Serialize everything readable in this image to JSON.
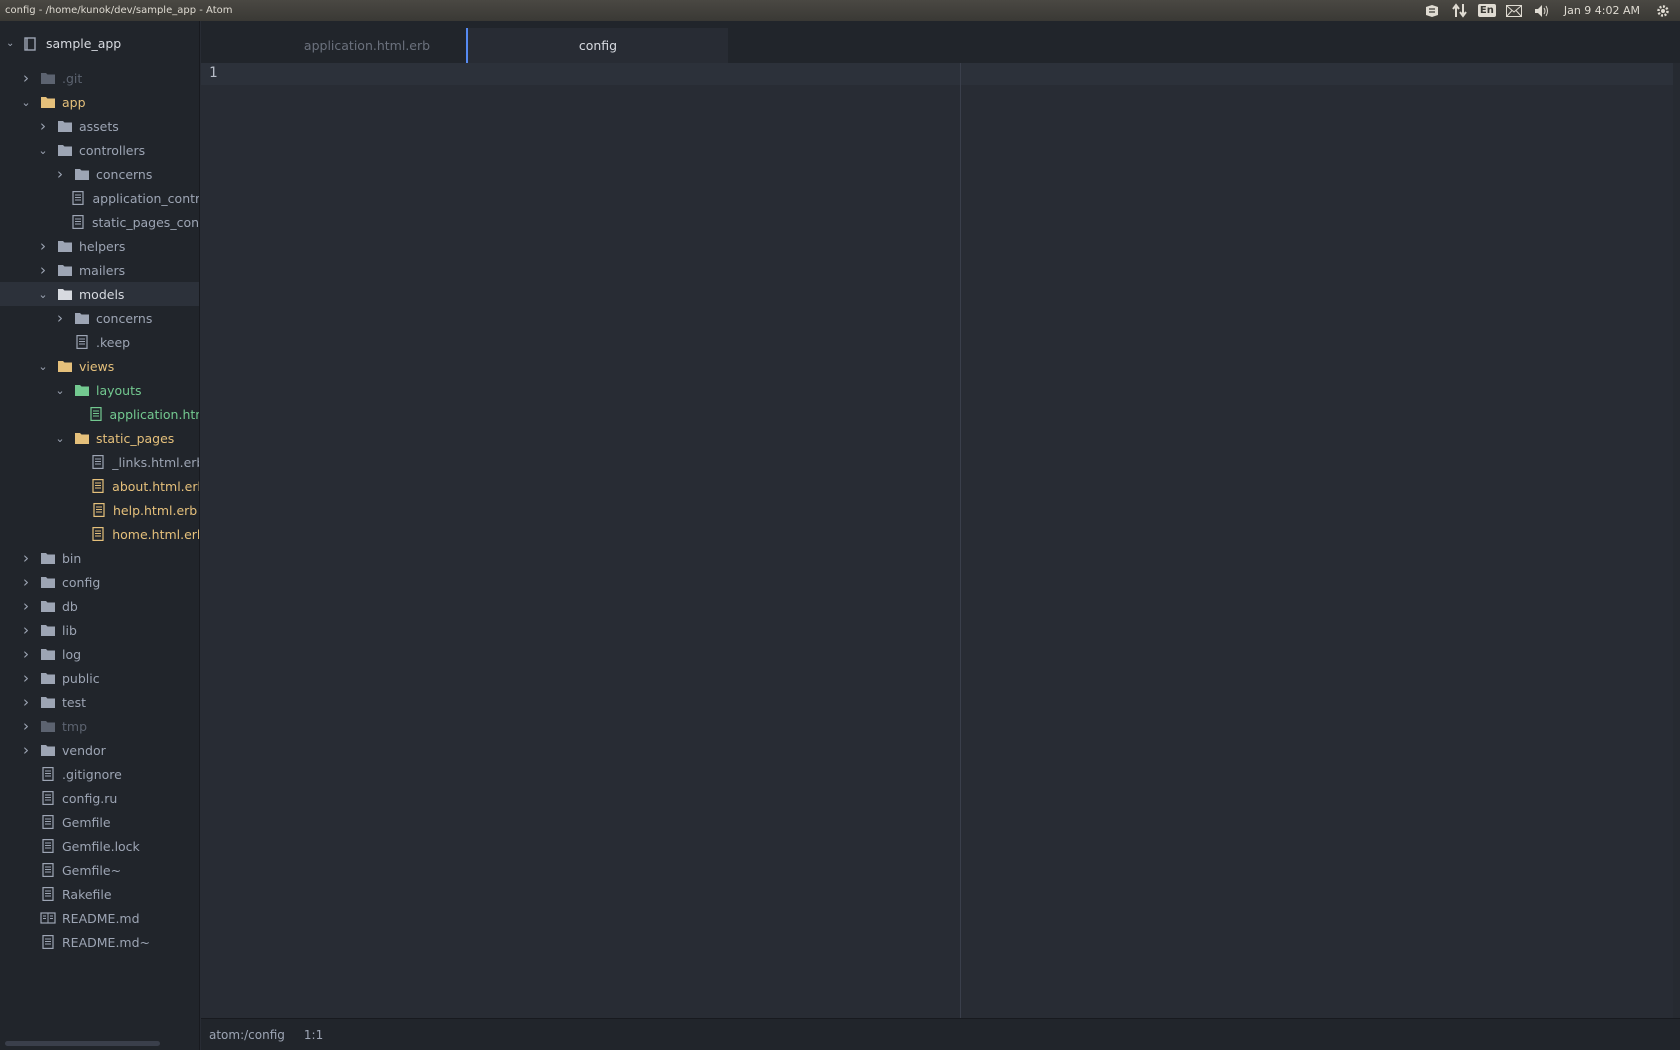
{
  "window": {
    "title": "config - /home/kunok/dev/sample_app - Atom",
    "clock": "Jan 9  4:02 AM",
    "keyboard_layout": "En"
  },
  "tree": {
    "root_label": "sample_app",
    "items": [
      {
        "label": ".git",
        "depth": 1,
        "type": "folder",
        "expanded": false,
        "status": "ignored"
      },
      {
        "label": "app",
        "depth": 1,
        "type": "folder",
        "expanded": true,
        "status": "modified"
      },
      {
        "label": "assets",
        "depth": 2,
        "type": "folder",
        "expanded": false,
        "status": ""
      },
      {
        "label": "controllers",
        "depth": 2,
        "type": "folder",
        "expanded": true,
        "status": ""
      },
      {
        "label": "concerns",
        "depth": 3,
        "type": "folder",
        "expanded": false,
        "status": ""
      },
      {
        "label": "application_controller.rb",
        "depth": 3,
        "type": "file",
        "status": ""
      },
      {
        "label": "static_pages_controller.rb",
        "depth": 3,
        "type": "file",
        "status": ""
      },
      {
        "label": "helpers",
        "depth": 2,
        "type": "folder",
        "expanded": false,
        "status": ""
      },
      {
        "label": "mailers",
        "depth": 2,
        "type": "folder",
        "expanded": false,
        "status": ""
      },
      {
        "label": "models",
        "depth": 2,
        "type": "folder",
        "expanded": true,
        "status": "",
        "selected": true
      },
      {
        "label": "concerns",
        "depth": 3,
        "type": "folder",
        "expanded": false,
        "status": ""
      },
      {
        "label": ".keep",
        "depth": 3,
        "type": "file",
        "status": ""
      },
      {
        "label": "views",
        "depth": 2,
        "type": "folder",
        "expanded": true,
        "status": "modified"
      },
      {
        "label": "layouts",
        "depth": 3,
        "type": "folder",
        "expanded": true,
        "status": "added"
      },
      {
        "label": "application.html.erb",
        "depth": 4,
        "type": "file",
        "status": "added"
      },
      {
        "label": "static_pages",
        "depth": 3,
        "type": "folder",
        "expanded": true,
        "status": "modified"
      },
      {
        "label": "_links.html.erb",
        "depth": 4,
        "type": "file",
        "status": ""
      },
      {
        "label": "about.html.erb",
        "depth": 4,
        "type": "file",
        "status": "modified"
      },
      {
        "label": "help.html.erb",
        "depth": 4,
        "type": "file",
        "status": "modified"
      },
      {
        "label": "home.html.erb",
        "depth": 4,
        "type": "file",
        "status": "modified"
      },
      {
        "label": "bin",
        "depth": 1,
        "type": "folder",
        "expanded": false,
        "status": ""
      },
      {
        "label": "config",
        "depth": 1,
        "type": "folder",
        "expanded": false,
        "status": ""
      },
      {
        "label": "db",
        "depth": 1,
        "type": "folder",
        "expanded": false,
        "status": ""
      },
      {
        "label": "lib",
        "depth": 1,
        "type": "folder",
        "expanded": false,
        "status": ""
      },
      {
        "label": "log",
        "depth": 1,
        "type": "folder",
        "expanded": false,
        "status": ""
      },
      {
        "label": "public",
        "depth": 1,
        "type": "folder",
        "expanded": false,
        "status": ""
      },
      {
        "label": "test",
        "depth": 1,
        "type": "folder",
        "expanded": false,
        "status": ""
      },
      {
        "label": "tmp",
        "depth": 1,
        "type": "folder",
        "expanded": false,
        "status": "ignored"
      },
      {
        "label": "vendor",
        "depth": 1,
        "type": "folder",
        "expanded": false,
        "status": ""
      },
      {
        "label": ".gitignore",
        "depth": 1,
        "type": "file",
        "status": ""
      },
      {
        "label": "config.ru",
        "depth": 1,
        "type": "file",
        "status": ""
      },
      {
        "label": "Gemfile",
        "depth": 1,
        "type": "file",
        "status": ""
      },
      {
        "label": "Gemfile.lock",
        "depth": 1,
        "type": "file",
        "status": ""
      },
      {
        "label": "Gemfile~",
        "depth": 1,
        "type": "file",
        "status": ""
      },
      {
        "label": "Rakefile",
        "depth": 1,
        "type": "file",
        "status": ""
      },
      {
        "label": "README.md",
        "depth": 1,
        "type": "markdown",
        "status": ""
      },
      {
        "label": "README.md~",
        "depth": 1,
        "type": "file",
        "status": ""
      }
    ]
  },
  "tabs": [
    {
      "label": "application.html.erb",
      "active": false
    },
    {
      "label": "config",
      "active": true
    }
  ],
  "editor": {
    "line_numbers": [
      "1"
    ]
  },
  "status_bar": {
    "path": "atom:/config",
    "cursor": "1:1"
  },
  "colors": {
    "accent": "#568af2",
    "modified": "#e5c07b",
    "added": "#73c990",
    "ignored": "#5c6370"
  }
}
